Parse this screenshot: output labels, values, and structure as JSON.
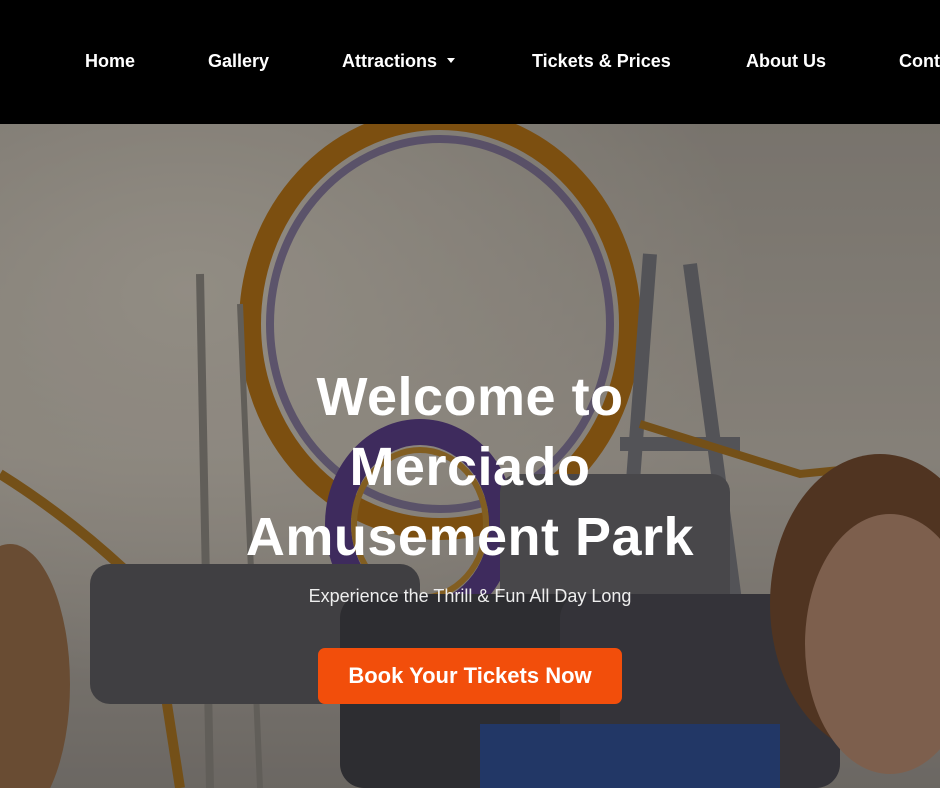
{
  "nav": {
    "home": "Home",
    "gallery": "Gallery",
    "attractions": "Attractions",
    "tickets": "Tickets & Prices",
    "about": "About Us",
    "contact": "Cont"
  },
  "hero": {
    "title_line1": "Welcome to",
    "title_line2": "Merciado",
    "title_line3": "Amusement Park",
    "subtitle": "Experience the Thrill & Fun All Day Long",
    "cta": "Book Your Tickets Now"
  },
  "colors": {
    "nav_bg": "#000000",
    "nav_text": "#ffffff",
    "cta_bg": "#f24e0b",
    "hero_text": "#ffffff"
  }
}
